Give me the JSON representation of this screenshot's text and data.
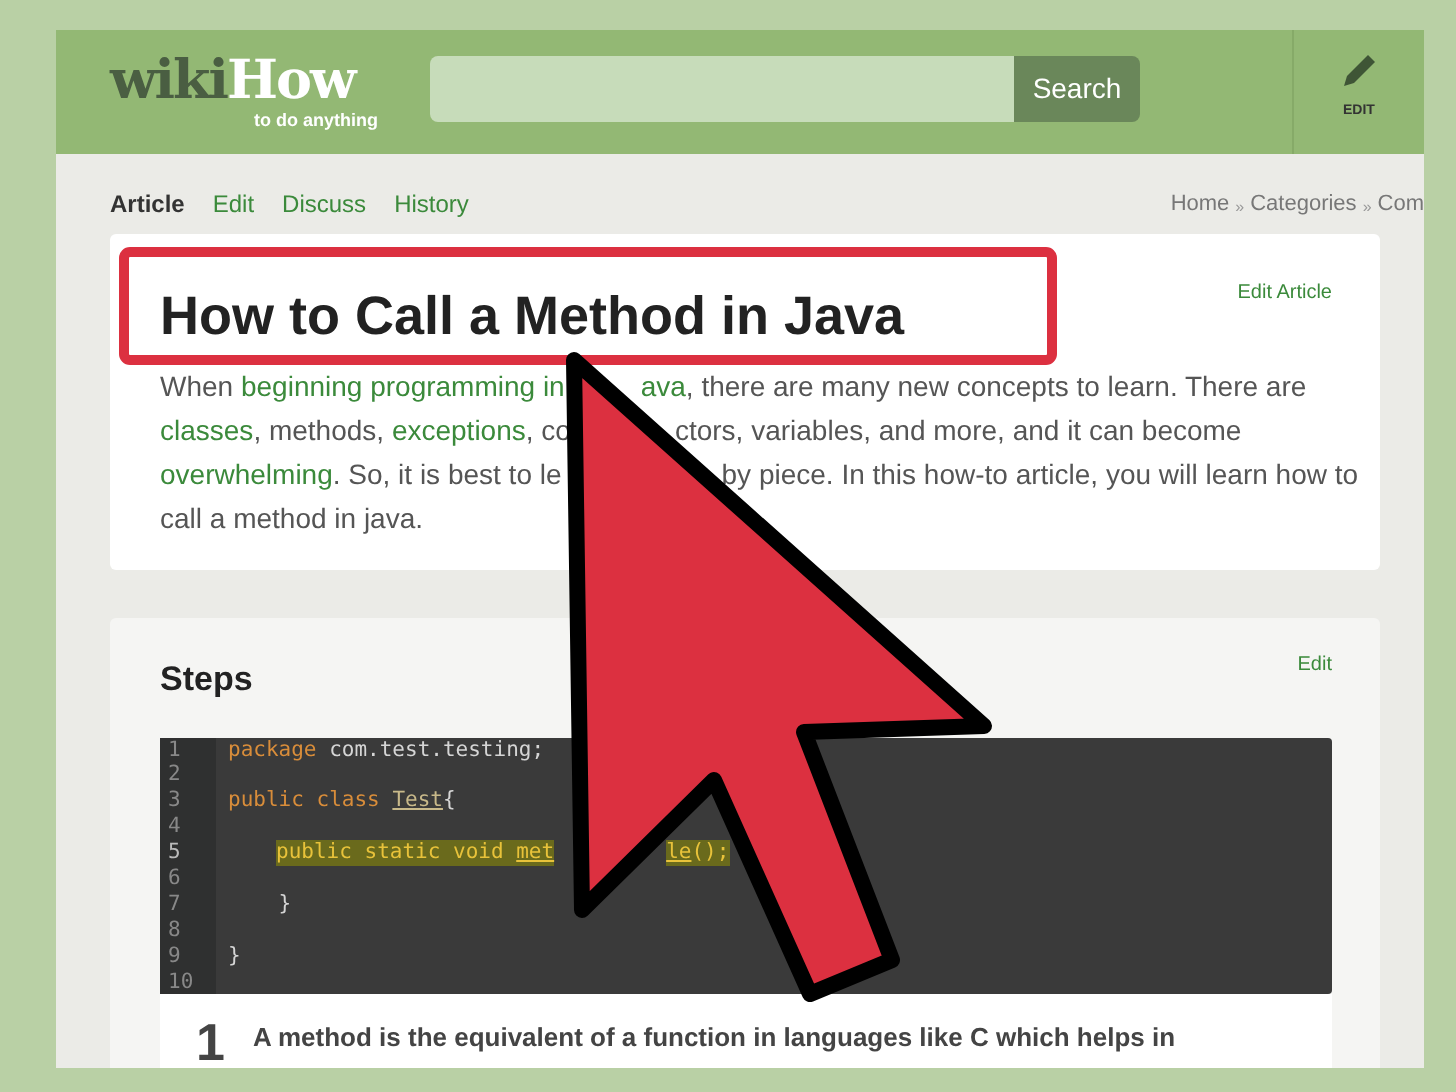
{
  "header": {
    "logo_dark": "wiki",
    "logo_light": "How",
    "tagline": "to do anything",
    "search_button": "Search",
    "edit_label": "EDIT"
  },
  "tabs": [
    {
      "label": "Article",
      "selected": true
    },
    {
      "label": "Edit",
      "selected": false
    },
    {
      "label": "Discuss",
      "selected": false
    },
    {
      "label": "History",
      "selected": false
    }
  ],
  "breadcrumb": [
    "Home",
    "»",
    "Categories",
    "»",
    "Com"
  ],
  "article": {
    "title": "How to Call a Method in Java",
    "edit_link": "Edit Article",
    "intro_lines": [
      [
        [
          {
            "text": "When ",
            "link": false
          },
          {
            "text": "beginning programming in",
            "link": true
          }
        ],
        [
          {
            "text": "ava",
            "link": true
          },
          {
            "text": ", there are many new concepts to learn. There are",
            "link": false
          }
        ]
      ],
      [
        [
          {
            "text": "classes",
            "link": true
          },
          {
            "text": ", methods, ",
            "link": false
          },
          {
            "text": "exceptions",
            "link": true
          },
          {
            "text": ", co",
            "link": false
          }
        ],
        [
          {
            "text": "ctors, variables, and more, and it can become",
            "link": false
          }
        ]
      ],
      [
        [
          {
            "text": "overwhelming",
            "link": true
          },
          {
            "text": ". So, it is best to le",
            "link": false
          }
        ],
        [
          {
            "text": "by piece. In this how-to article, you will learn how to",
            "link": false
          }
        ]
      ],
      [
        [
          {
            "text": "call a method in java.",
            "link": false
          }
        ]
      ]
    ]
  },
  "steps": {
    "heading": "Steps",
    "edit_link": "Edit",
    "code_lines": [
      {
        "number": "1",
        "highlighted": false,
        "pieces": [
          [
            {
              "kind": "keyword",
              "text": "package "
            },
            {
              "kind": "plain",
              "text": "com.test.testing;"
            }
          ]
        ]
      },
      {
        "number": "2",
        "highlighted": false
      },
      {
        "number": "3",
        "highlighted": false,
        "pieces": [
          [
            {
              "kind": "keyword",
              "text": "public class "
            },
            {
              "kind": "type",
              "text": "Test"
            },
            {
              "kind": "plain",
              "text": "{"
            }
          ]
        ]
      },
      {
        "number": "4",
        "highlighted": false
      },
      {
        "number": "5",
        "highlighted": true,
        "pieces": [
          [
            {
              "kind": "keyword",
              "text": "public static void "
            },
            {
              "kind": "type",
              "text": "met"
            }
          ],
          [
            {
              "kind": "type",
              "text": "le"
            },
            {
              "kind": "plain",
              "text": "();"
            }
          ]
        ]
      },
      {
        "number": "6",
        "highlighted": false
      },
      {
        "number": "7",
        "highlighted": false,
        "pieces": [
          [
            {
              "kind": "plain",
              "text": "    }"
            }
          ]
        ]
      },
      {
        "number": "8",
        "highlighted": false
      },
      {
        "number": "9",
        "highlighted": false,
        "pieces": [
          [
            {
              "kind": "plain",
              "text": "}"
            }
          ]
        ]
      },
      {
        "number": "10",
        "highlighted": false
      }
    ],
    "step_number": "1",
    "step_text": "A method is the equivalent of a function in languages like C which helps in"
  }
}
